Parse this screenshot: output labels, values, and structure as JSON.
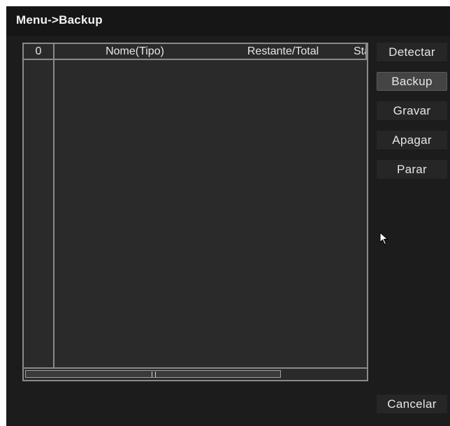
{
  "window": {
    "title": "Menu->Backup"
  },
  "table": {
    "columns": [
      {
        "label": "0"
      },
      {
        "label": "Nome(Tipo)"
      },
      {
        "label": "Restante/Total"
      },
      {
        "label": "Sta"
      }
    ],
    "rows": []
  },
  "buttons": {
    "detect": "Detectar",
    "backup": "Backup",
    "burn": "Gravar",
    "erase": "Apagar",
    "stop": "Parar",
    "cancel": "Cancelar"
  },
  "colors": {
    "window_bg": "#1c1c1c",
    "table_bg": "#2a2a2a",
    "border": "#8a8a8a",
    "text": "#e6e6e6",
    "active_button": "#444444"
  }
}
